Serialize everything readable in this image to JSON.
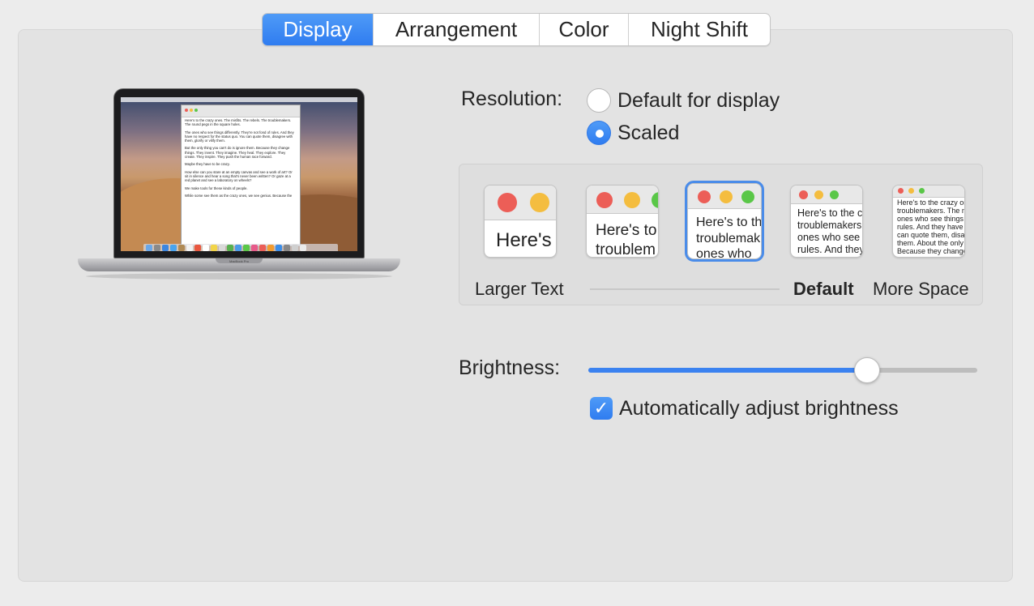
{
  "tabs": [
    {
      "label": "Display",
      "active": true
    },
    {
      "label": "Arrangement",
      "active": false
    },
    {
      "label": "Color",
      "active": false
    },
    {
      "label": "Night Shift",
      "active": false
    }
  ],
  "laptop": {
    "base_label": "MacBook Pro",
    "document_paragraphs": [
      "Here's to the crazy ones. The misfits. The rebels. The troublemakers. The round pegs in the square holes.",
      "The ones who see things differently. They're not fond of rules. And they have no respect for the status quo. You can quote them, disagree with them, glorify or vilify them.",
      "But the only thing you can't do is ignore them. Because they change things. They invent. They imagine. They heal. They explore. They create. They inspire. They push the human race forward.",
      "Maybe they have to be crazy.",
      "How else can you stare at an empty canvas and see a work of art? Or sit in silence and hear a song that's never been written? Or gaze at a red planet and see a laboratory on wheels?",
      "We make tools for these kinds of people.",
      "While some see them as the crazy ones, we see genius. Because the"
    ]
  },
  "resolution": {
    "label": "Resolution:",
    "options": [
      {
        "label": "Default for display",
        "selected": false
      },
      {
        "label": "Scaled",
        "selected": true
      }
    ]
  },
  "scaling": {
    "thumbnails": [
      {
        "text": "Here's",
        "selected": false
      },
      {
        "text": "Here's to troublem",
        "selected": false
      },
      {
        "text": "Here's to th troublemak ones who",
        "selected": true
      },
      {
        "text": "Here's to the cr troublemakers. ones who see t rules. And they",
        "selected": false
      },
      {
        "text": "Here's to the crazy ones troublemakers. The rou ones who see things dif rules. And they have no can quote them, disagre them. About the only th Because they change th",
        "selected": false
      }
    ],
    "label_left": "Larger Text",
    "label_default": "Default",
    "label_right": "More Space"
  },
  "brightness": {
    "label": "Brightness:",
    "level": 0.716,
    "auto_label": "Automatically adjust brightness",
    "auto_checked": true
  },
  "colors": {
    "accent": "#3b82f0",
    "red": "#ec5e57",
    "yellow": "#f4bd3f",
    "green": "#5ac748"
  }
}
